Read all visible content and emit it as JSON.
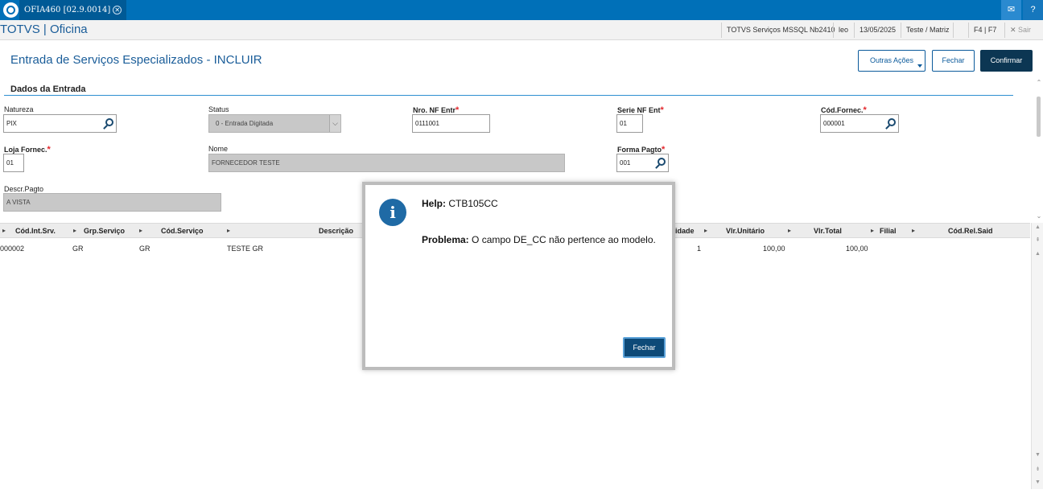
{
  "topbar": {
    "tab_label": "OFIA460 [02.9.0014]",
    "tab_close": "✕",
    "mail_icon": "mail-icon",
    "help_icon": "help-icon"
  },
  "appbar": {
    "title": "TOTVS | Oficina",
    "environment": "TOTVS Serviços MSSQL Nb2410",
    "user": "leo",
    "date": "13/05/2025",
    "company": "Teste / Matriz",
    "shortcuts": "F4 | F7",
    "exit_label": "Sair"
  },
  "page": {
    "title": "Entrada de Serviços Especializados - INCLUIR",
    "buttons": {
      "outras_acoes": "Outras Ações",
      "fechar": "Fechar",
      "confirmar": "Confirmar"
    }
  },
  "form": {
    "section_title": "Dados da Entrada",
    "natureza": {
      "label": "Natureza",
      "value": "PIX"
    },
    "status": {
      "label": "Status",
      "value": "0 - Entrada Digitada"
    },
    "nro_nf": {
      "label": "Nro. NF Entr",
      "value": "0111001"
    },
    "serie_nf": {
      "label": "Serie NF Ent",
      "value": "01"
    },
    "cod_fornec": {
      "label": "Cód.Fornec.",
      "value": "000001"
    },
    "loja_fornec": {
      "label": "Loja Fornec.",
      "value": "01"
    },
    "nome": {
      "label": "Nome",
      "value": "FORNECEDOR TESTE"
    },
    "forma_pagto": {
      "label": "Forma Pagto",
      "value": "001"
    },
    "descr_pagto": {
      "label": "Descr.Pagto",
      "value": "A VISTA"
    },
    "required_mark": "*"
  },
  "grid": {
    "headers": {
      "cod_int_srv": "Cód.Int.Srv.",
      "grp_servico": "Grp.Serviço",
      "cod_servico": "Cód.Serviço",
      "descricao": "Descrição",
      "quantidade": "idade",
      "vlr_unitario": "Vlr.Unitário",
      "vlr_total": "Vlr.Total",
      "filial": "Filial",
      "cod_rel_said": "Cód.Rel.Said"
    },
    "row": {
      "cod_int_srv": "000002",
      "grp_servico": "GR",
      "cod_servico": "GR",
      "descricao": "TESTE GR",
      "quantidade": "1",
      "vlr_unitario": "100,00",
      "vlr_total": "100,00"
    }
  },
  "modal": {
    "help_label": "Help:",
    "help_code": "CTB105CC",
    "problem_label": "Problema:",
    "problem_text": "O campo DE_CC não pertence ao modelo.",
    "close_button": "Fechar"
  }
}
